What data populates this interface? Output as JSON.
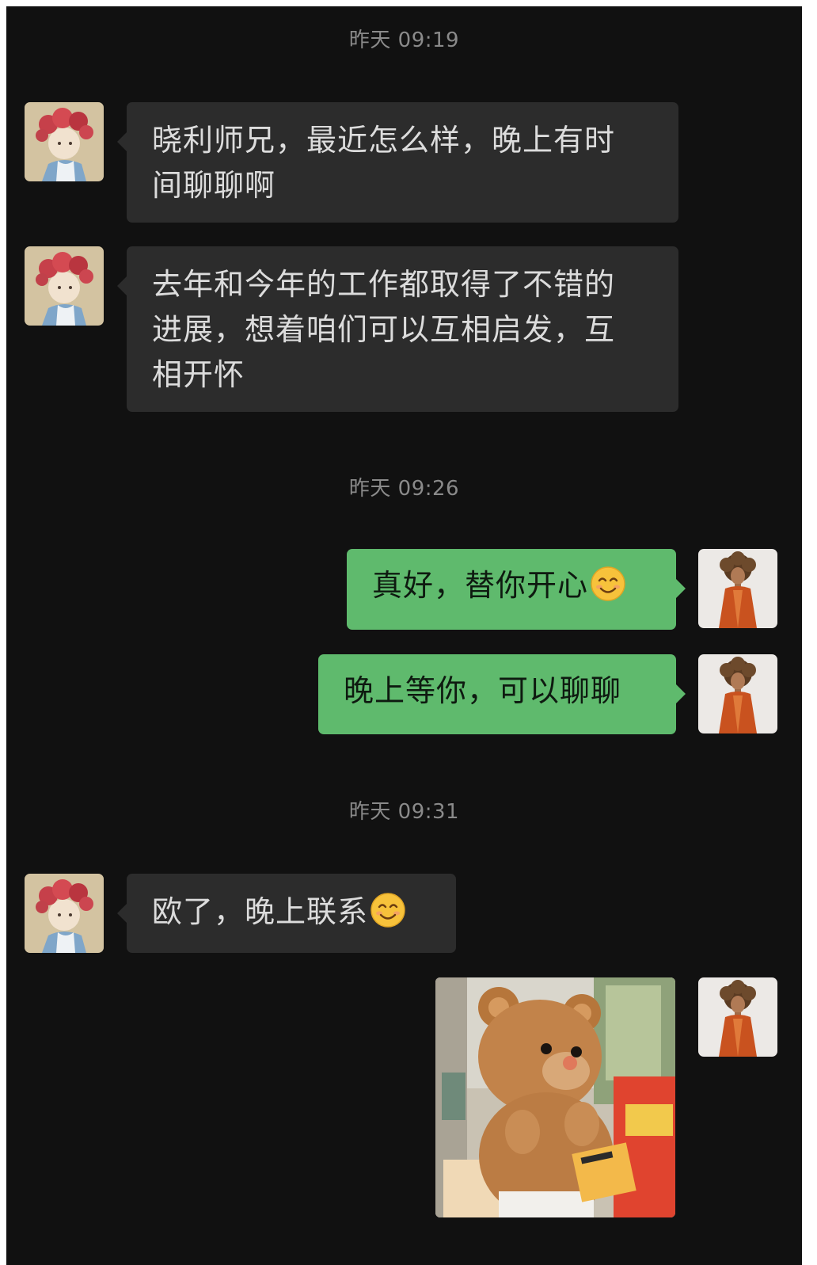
{
  "colors": {
    "background": "#111111",
    "incoming_bubble": "#2c2c2c",
    "outgoing_bubble": "#5fba6d",
    "timestamp_text": "#8a8a8a"
  },
  "timestamps": [
    "昨天 09:19",
    "昨天 09:26",
    "昨天 09:31"
  ],
  "messages": [
    {
      "side": "incoming",
      "text": "晓利师兄，最近怎么样，晚上有时间聊聊啊",
      "lines": [
        "晓利师兄，最近怎么样，晚上有时",
        "间聊聊啊"
      ]
    },
    {
      "side": "incoming",
      "text": "去年和今年的工作都取得了不错的进展，想着咱们可以互相启发，互相开怀",
      "lines": [
        "去年和今年的工作都取得了不错的",
        "进展，想着咱们可以互相启发，互",
        "相开怀"
      ]
    },
    {
      "side": "outgoing",
      "text": "真好，替你开心",
      "emoji": "smiling-face-emoji"
    },
    {
      "side": "outgoing",
      "text": "晚上等你，可以聊聊"
    },
    {
      "side": "incoming",
      "text": "欧了，晚上联系",
      "emoji": "smiling-face-emoji"
    },
    {
      "side": "outgoing",
      "type": "image",
      "image": "teddy-bear-photo"
    }
  ],
  "avatars": {
    "incoming": "flower-crown-illustration-avatar",
    "outgoing": "curly-hair-character-avatar"
  }
}
